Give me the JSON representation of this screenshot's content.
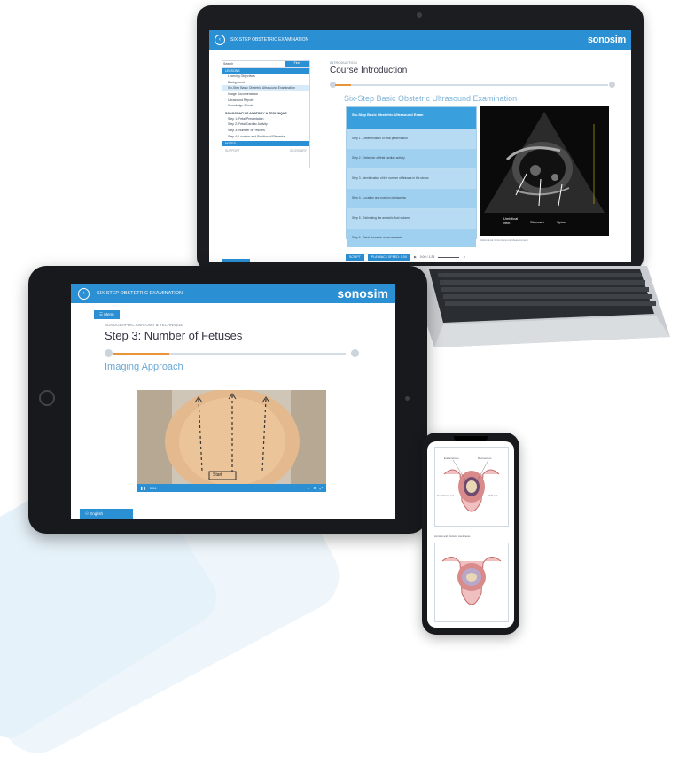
{
  "colors": {
    "accent": "#2a8fd3",
    "progress": "#e8953a",
    "subtitle": "#7fb4d9"
  },
  "laptop": {
    "header_title": "SIX-STEP OBSTETRIC EXAMINATION",
    "brand": "sonosim",
    "search_placeholder": "Search",
    "search_button": "Find",
    "lessons_header": "LESSONS",
    "lessons": [
      "Learning Objectives",
      "Background",
      "Six-Step Basic Obstetric Ultrasound Examination",
      "Image Documentation",
      "Ultrasound Report",
      "Knowledge Check"
    ],
    "section_header": "SONOGRAPHIC ANATOMY & TECHNIQUE",
    "steps": [
      "Step 1: Fetal Presentation",
      "Step 2: Fetal Cardiac Activity",
      "Step 3: Number of Fetuses",
      "Step 4: Location and Position of Placenta"
    ],
    "notes_label": "NOTES",
    "foot_left": "SUPPORT",
    "foot_right": "GLOSSARY",
    "breadcrumb": "INTRODUCTION",
    "title": "Course Introduction",
    "progress": 0.06,
    "subtitle": "Six-Step Basic Obstetric Ultrasound Examination",
    "table_header": "Six-Step Basic Obstetric Ultrasound Exam",
    "table_rows": [
      "Step 1 - Determination of fetal presentation",
      "Step 2 - Detection of fetal cardiac activity",
      "Step 3 - Identification of the number of fetuses in the uterus",
      "Step 4 - Location and position of placenta",
      "Step 5 - Estimating the amniotic fluid volume",
      "Step 6 - Fetal biometric measurements"
    ],
    "us_labels": {
      "left": "Umbilical vein",
      "mid": "Stomach",
      "right": "Spine"
    },
    "image_caption": "Abdominal Circumference Measurement",
    "script_btn": "SCRIPT",
    "speed_btn": "PLAYBACK SPEED: 1.0X",
    "time": "0:00 / 1:28"
  },
  "tablet": {
    "header_title": "SIX-STEP OBSTETRIC EXAMINATION",
    "brand": "sonosim",
    "menu": "Menu",
    "breadcrumb": "SONOGRAPHIC ANATOMY & TECHNIQUE",
    "title": "Step 3: Number of Fetuses",
    "progress": 0.24,
    "subtitle": "Imaging Approach",
    "video_label_start": "Start",
    "video_time": "0:04",
    "language": "English"
  },
  "phone": {
    "labels_top": {
      "left": "Endometrium",
      "right": "Myometrium",
      "gs": "Gestational sac",
      "yolk": "Yolk sac"
    },
    "caption": "Amniotic and chorionic membranes"
  }
}
